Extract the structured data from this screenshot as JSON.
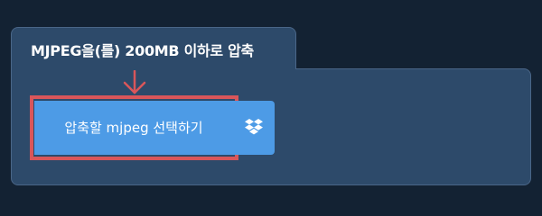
{
  "tab": {
    "title": "MJPEG을(를) 200MB 이하로 압축"
  },
  "upload": {
    "button_label": "압축할 mjpeg 선택하기",
    "dropbox_icon": "dropbox-icon"
  },
  "colors": {
    "background": "#132233",
    "panel": "#2d4a6a",
    "button": "#4d9be6",
    "highlight": "#d9565a"
  }
}
